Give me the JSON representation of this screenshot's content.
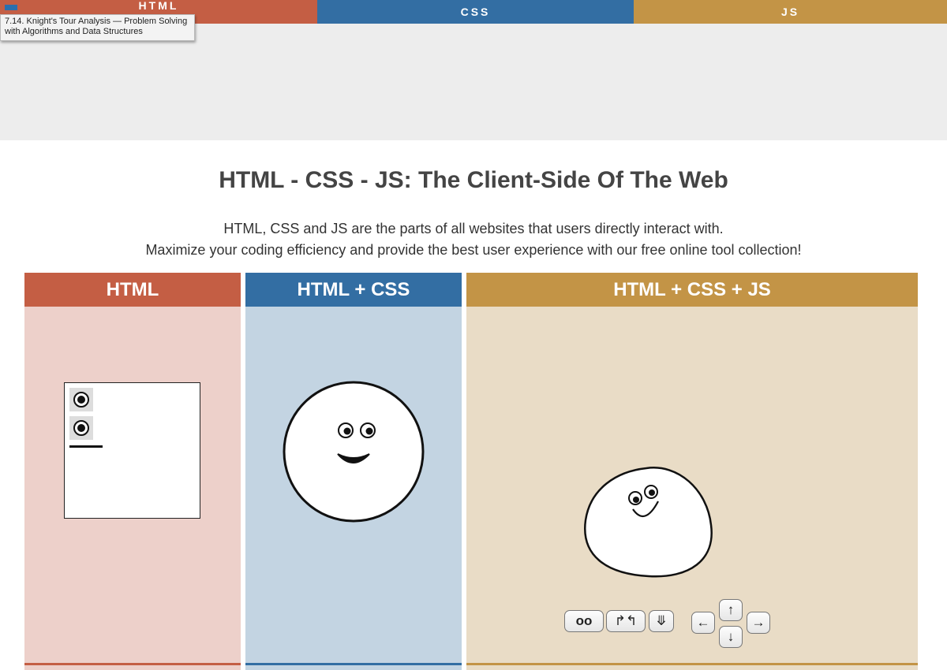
{
  "top_nav": {
    "tabs": [
      {
        "label": "HTML"
      },
      {
        "label": "CSS"
      },
      {
        "label": "JS"
      }
    ]
  },
  "tooltip": {
    "line1": "7.14. Knight's Tour Analysis — Problem Solving",
    "line2": "with Algorithms and Data Structures"
  },
  "main": {
    "title": "HTML - CSS - JS: The Client-Side Of The Web",
    "intro_line1": "HTML, CSS and JS are the parts of all websites that users directly interact with.",
    "intro_line2": "Maximize your coding efficiency and provide the best user experience with our free online tool collection!"
  },
  "panels": [
    {
      "title": "HTML"
    },
    {
      "title": "HTML + CSS"
    },
    {
      "title": "HTML + CSS + JS"
    }
  ],
  "controls": {
    "eyes": "oo",
    "rotate": "↱↰",
    "down_double": "⤋",
    "left": "←",
    "up": "↑",
    "down": "↓",
    "right": "→"
  },
  "colors": {
    "html": "#c45e44",
    "css": "#336ea3",
    "js": "#c39446"
  }
}
